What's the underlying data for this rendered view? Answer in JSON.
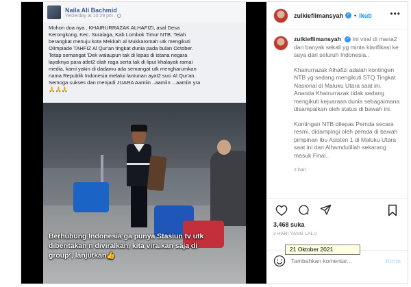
{
  "media": {
    "fb_name": "Naila Ali Bachmid",
    "fb_time": "Yesterday at 10:29 pm ·",
    "fb_lines": [
      "Mohon doa nya ,  KHAIRURRAZAK ALHAFIZI, asal Desa",
      "Kerongkong, Kec. Suralaga, Kab Lombok Timur NTB. Telah",
      "berangkat menuju kota Mekkah al Mukkaromah utk mengikuti",
      "Olimpiade TAHFIZ Al Qur'an tingkat dunia pada bulan October.",
      "Tetap semangat 'Dek walaupun tak di lepas di istana negara",
      "layaknya para atlet2 olah raga serta tak di liput khalayak ramai",
      "media, kami yakin di dadamu ada semangat utk mengharumkan",
      "nama Republik Indonesia melalui lantunan ayat2 suci Al Qur'an.",
      "Semoga sukses dan menjadi JUARA Aamiin ..aamiin ...aamiin yra"
    ],
    "fb_emoji": "🙏🙏🙏",
    "caption_lines": [
      "Berhubung Indonesia ga punya Stasiun tv utk",
      "diberitakan n diviralkan, kita viralkan saja di",
      "group², lanjutkan👍"
    ]
  },
  "header": {
    "username": "zulkieflimansyah",
    "verified": "✓",
    "separator": "•",
    "follow": "Ikuti",
    "more": "•••"
  },
  "caption": {
    "username": "zulkieflimansyah",
    "intro_lines": [
      "Ini viral di mana2",
      "dan banyak sekali yg minta klarifikasi ke",
      "saya dari seluruh Indonesia.."
    ],
    "p2_lines": [
      "Khairurrazak Alhafizi adalah kontingen",
      "NTB yg sedang mengikuti STQ Tingkat",
      "Nasional di Maluku Utara saat ini.",
      "Ananda Khairurrazak tidak sedang",
      "mengikuti kejuaraan dunia sebagaimana",
      "disampaikan oleh status di bawah ini."
    ],
    "p3_lines": [
      "Kontingan NTB dilepas Pemda secara",
      "resmi, didampingi oleh pemda di bawah",
      "pimpinan Ibu Asisten 1 di Maluku Utara",
      "saat ini dan Alhamdulillah sekarang",
      "masuk Final.."
    ],
    "age": "2 hari"
  },
  "engagement": {
    "likes": "3,468 suka",
    "date": "2 HARI YANG LALU",
    "tooltip": "21 Oktober 2021"
  },
  "comment_box": {
    "placeholder": "Tambahkan komentar...",
    "post_label": "Kirim"
  }
}
